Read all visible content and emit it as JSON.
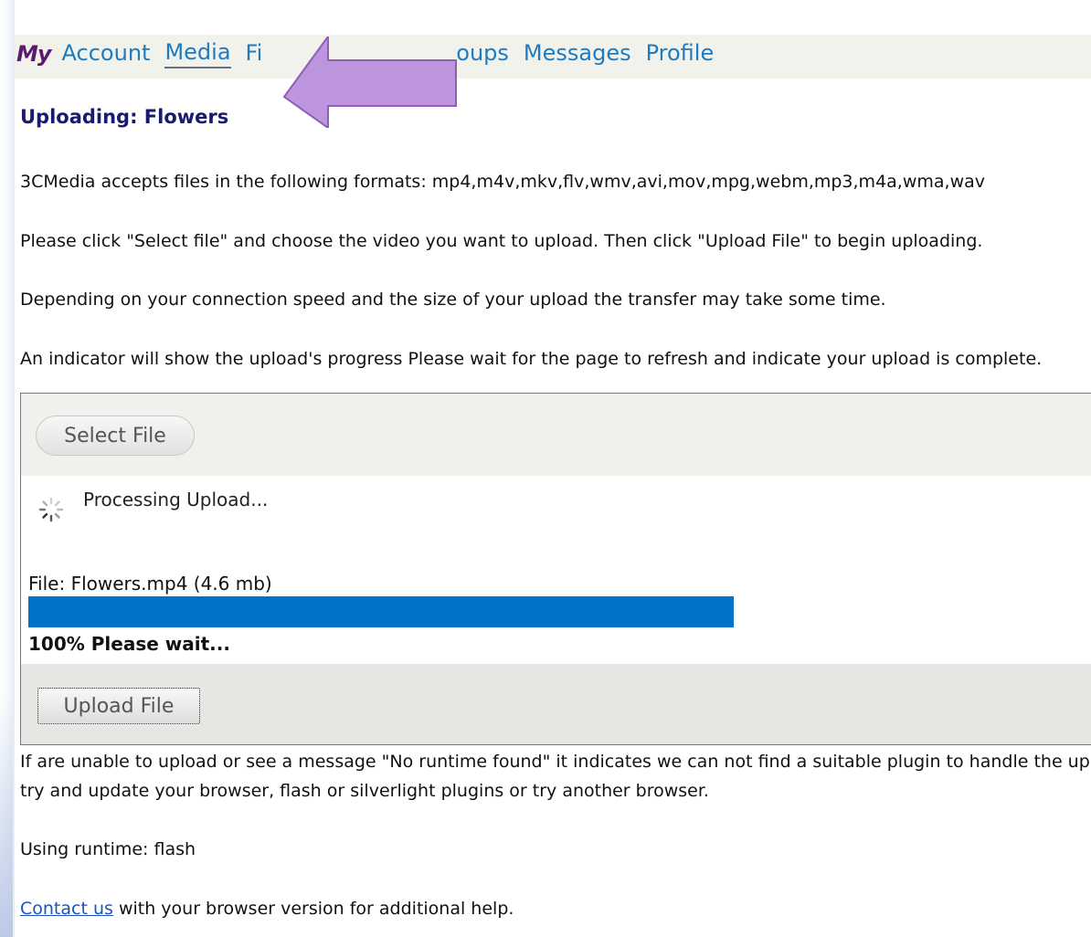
{
  "nav": {
    "brand": "My",
    "items": [
      {
        "label": "Account",
        "active": false
      },
      {
        "label": "Media",
        "active": true
      },
      {
        "label": "Fi",
        "active": false
      },
      {
        "label": "oups",
        "active": false
      },
      {
        "label": "Messages",
        "active": false
      },
      {
        "label": "Profile",
        "active": false
      }
    ]
  },
  "page": {
    "title": "Uploading: Flowers",
    "formats_text": "3CMedia accepts files in the following formats: mp4,m4v,mkv,flv,wmv,avi,mov,mpg,webm,mp3,m4a,wma,wav",
    "instructions_text": "Please click \"Select file\" and choose the video you want to upload. Then click \"Upload File\" to begin uploading.",
    "speed_text": "Depending on your connection speed and the size of your upload the transfer may take some time.",
    "indicator_text": "An indicator will show the upload's progress Please wait for the page to refresh and indicate your upload is complete."
  },
  "uploader": {
    "select_button": "Select File",
    "processing_text": "Processing Upload...",
    "file_line": "File: Flowers.mp4 (4.6 mb)",
    "progress_fraction": 1.0,
    "progress_text": "100% Please wait...",
    "upload_button": "Upload File",
    "progress_color": "#0073c9"
  },
  "footer": {
    "runtime_note_line1": "If are unable to upload or see a message \"No runtime found\" it indicates we can not find a suitable plugin to handle the upl",
    "runtime_note_line2": "try and update your browser, flash or silverlight plugins or try another browser.",
    "runtime_used": "Using runtime: flash",
    "contact_link": "Contact us",
    "contact_suffix": " with your browser version for additional help."
  },
  "colors": {
    "arrow": "#b98ddb",
    "brand": "#5a1d6e",
    "nav_link": "#1f7bbf",
    "title": "#1a1a6e"
  }
}
